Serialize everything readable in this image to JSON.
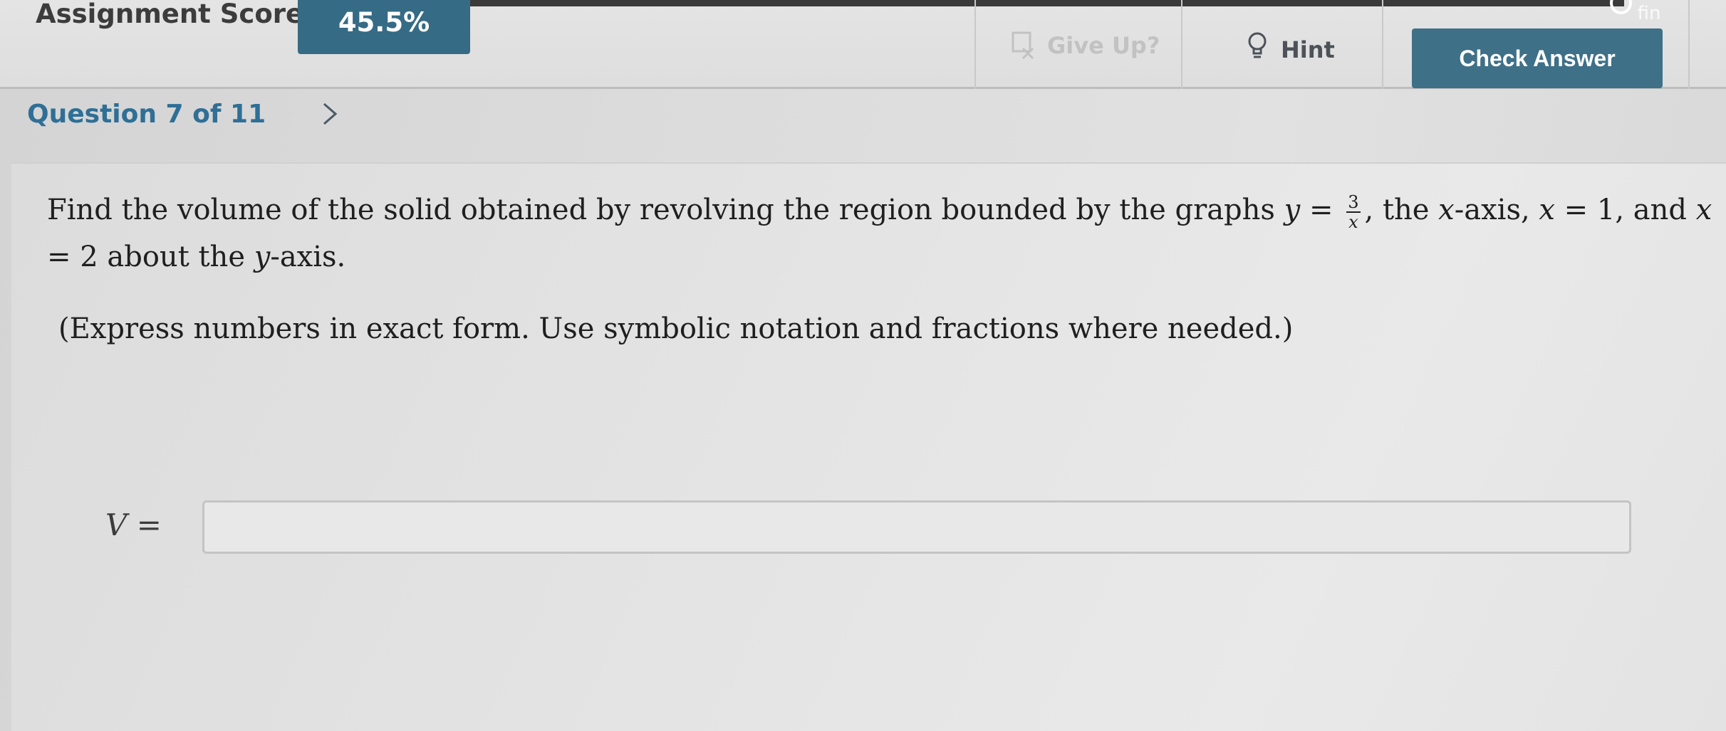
{
  "header": {
    "score_label": "Assignment Score:",
    "score_value": "45.5%",
    "give_up_label": "Give Up?",
    "hint_label": "Hint",
    "check_answer_label": "Check Answer",
    "help_link_label": "How to fin"
  },
  "question_nav": {
    "label": "Question 7 of 11"
  },
  "problem": {
    "part1": "Find the volume of the solid obtained by revolving the region bounded by the graphs ",
    "y_var": "y",
    "equals": " = ",
    "frac_num": "3",
    "frac_den": "x",
    "part2": ", the ",
    "x_var": "x",
    "part3": "-axis, ",
    "x_eq1_var": "x",
    "x_eq1": " = 1, and ",
    "x_eq2_var": "x",
    "x_eq2": " = 2 about the ",
    "y_axis_var": "y",
    "part4": "-axis.",
    "instruction": "(Express numbers in exact form. Use symbolic notation and fractions where needed.)"
  },
  "answer": {
    "label_var": "V",
    "label_eq": " =",
    "value": "",
    "placeholder": ""
  },
  "colors": {
    "accent": "#356b85",
    "button": "#3e7088",
    "link": "#2f6f96"
  }
}
